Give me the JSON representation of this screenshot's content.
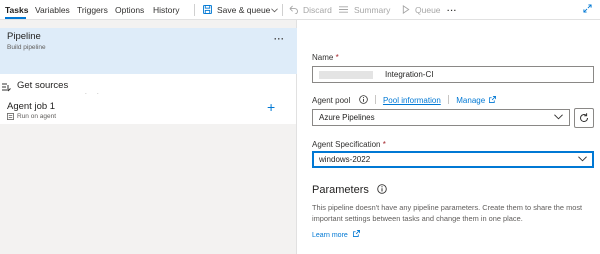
{
  "toolbar": {
    "tabs": [
      "Tasks",
      "Variables",
      "Triggers",
      "Options",
      "History"
    ],
    "save_queue": "Save & queue",
    "discard": "Discard",
    "summary": "Summary",
    "queue": "Queue",
    "more": "···"
  },
  "left": {
    "pipeline_title": "Pipeline",
    "pipeline_subtitle": "Build pipeline",
    "more": "···",
    "get_sources": "Get sources",
    "branch": "develop",
    "agent_job": "Agent job 1",
    "agent_job_sub": "Run on agent",
    "add": "+"
  },
  "right": {
    "name_label": "Name",
    "required_mark": "*",
    "name_value_suffix": "Integration-CI",
    "agent_pool_label": "Agent pool",
    "pool_information": "Pool information",
    "manage": "Manage",
    "agent_pool_value": "Azure Pipelines",
    "agent_spec_label": "Agent Specification",
    "agent_spec_value": "windows-2022",
    "parameters_title": "Parameters",
    "parameters_desc": "This pipeline doesn't have any pipeline parameters. Create them to share the most important settings between tasks and change them in one place.",
    "learn_more": "Learn more"
  },
  "colors": {
    "accent": "#0078d4",
    "selected_bg": "#deecf9",
    "pane_bg": "#f3f2f1",
    "required": "#a4262c"
  }
}
